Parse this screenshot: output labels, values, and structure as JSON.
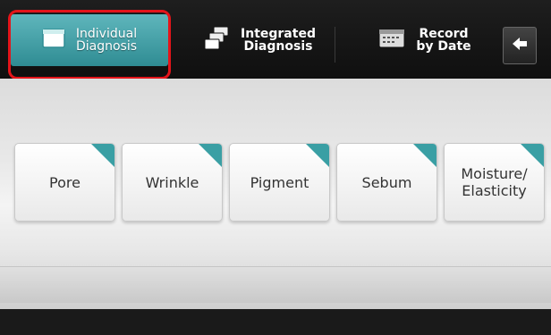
{
  "tabs": [
    {
      "label": "Individual\nDiagnosis",
      "icon": "window-icon",
      "active": true
    },
    {
      "label": "Integrated\nDiagnosis",
      "icon": "stacked-windows-icon",
      "active": false
    },
    {
      "label": "Record\nby Date",
      "icon": "calendar-icon",
      "active": false
    }
  ],
  "back_icon": "back-arrow-icon",
  "categories": [
    {
      "label": "Pore"
    },
    {
      "label": "Wrinkle"
    },
    {
      "label": "Pigment"
    },
    {
      "label": "Sebum"
    },
    {
      "label": "Moisture/\nElasticity"
    }
  ],
  "colors": {
    "accent": "#3a9fa4",
    "highlight": "#e4141a"
  }
}
